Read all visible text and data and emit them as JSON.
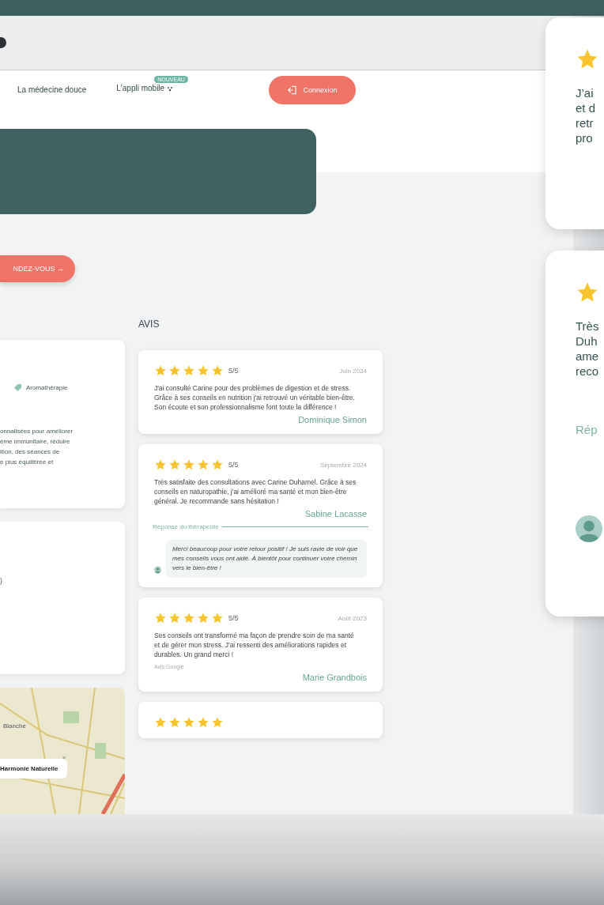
{
  "nav": {
    "items": [
      {
        "label": "La médecine douce"
      },
      {
        "label": "L'appli mobile",
        "badge": "NOUVEAU"
      }
    ],
    "login_button": "Connexion"
  },
  "appointment_button": "NDEZ-VOUS →",
  "left_column": {
    "tag": "Aromathérapie",
    "description_lines": [
      "onnalisées pour améliorer",
      "ème immunitaire, réduire",
      "ition, des séances de",
      "e plus équilibrée et"
    ],
    "card_fragment": ")",
    "map": {
      "place_label": "Blanche",
      "popup": "Harmonie Naturelle",
      "popup_close": "×"
    }
  },
  "reviews_heading": "AVIS",
  "reviews": [
    {
      "stars": 5,
      "score": "5/5",
      "date": "Juin 2024",
      "text": "J'ai consulté Carine pour des problèmes de digestion et de stress. Grâce à ses conseils en nutrition j'ai retrouvé un véritable bien-être. Son écoute et son professionnalisme font toute la différence !",
      "author": "Dominique Simon"
    },
    {
      "stars": 5,
      "score": "5/5",
      "date": "Septembre 2024",
      "text": "Très satisfaite des consultations avec Carine Duhamel. Grâce à ses conseils en naturopathie, j'ai amélioré ma santé et mon bien-être général. Je recommande sans hésitation !",
      "author": "Sabine Lacasse",
      "response_label": "Réponse du thérapeute",
      "response": "Merci beaucoup pour votre retour positif ! Je suis ravie de voir que mes conseils vous ont aidé. À bientôt pour continuer votre chemin vers le bien-être !"
    },
    {
      "stars": 5,
      "score": "5/5",
      "date": "Août 2023",
      "text": "Ses conseils ont transformé ma façon de prendre soin de ma santé et de gérer mon stress. J'ai ressenti des améliorations rapides et durables. Un grand merci !",
      "source": "Avis Google",
      "author": "Marie Grandbois"
    },
    {
      "stars": 5
    }
  ],
  "floating_cards": [
    {
      "lines": [
        "J’ai",
        "et d",
        "retr",
        "pro"
      ]
    },
    {
      "lines": [
        "Très",
        "Duh",
        "ame",
        "reco"
      ],
      "response_label": "Rép"
    }
  ]
}
